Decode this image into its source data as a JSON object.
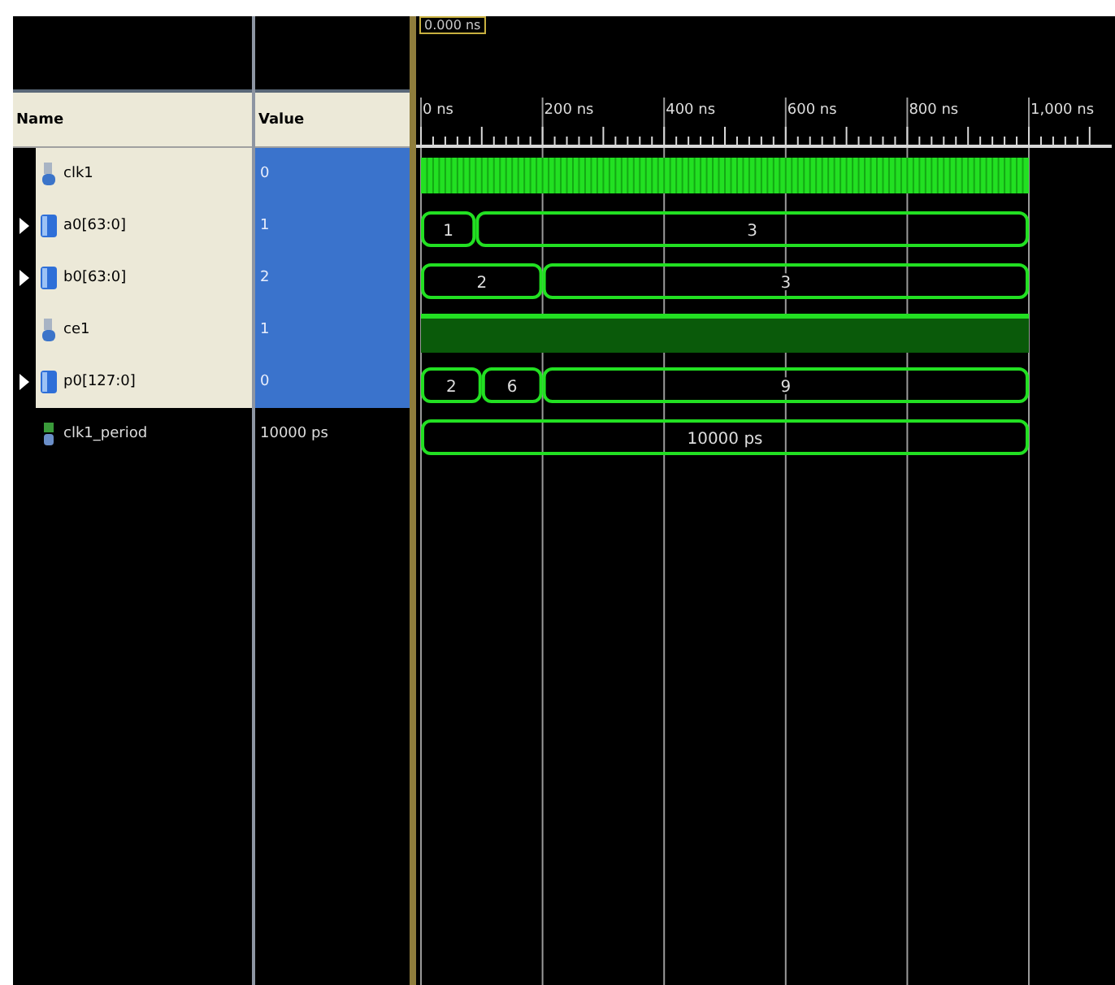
{
  "cursor": {
    "label": "0.000 ns"
  },
  "columns": {
    "name": "Name",
    "value": "Value"
  },
  "ruler": {
    "ticks": [
      "0 ns",
      "200 ns",
      "400 ns",
      "600 ns",
      "800 ns",
      "1,000 ns"
    ]
  },
  "signals": [
    {
      "name": "clk1",
      "value": "0",
      "kind": "clock",
      "selected": true
    },
    {
      "name": "a0[63:0]",
      "value": "1",
      "kind": "bus",
      "selected": true,
      "segments": [
        {
          "label": "1"
        },
        {
          "label": "3"
        }
      ]
    },
    {
      "name": "b0[63:0]",
      "value": "2",
      "kind": "bus",
      "selected": true,
      "segments": [
        {
          "label": "2"
        },
        {
          "label": "3"
        }
      ]
    },
    {
      "name": "ce1",
      "value": "1",
      "kind": "high",
      "selected": true
    },
    {
      "name": "p0[127:0]",
      "value": "0",
      "kind": "bus",
      "selected": true,
      "segments": [
        {
          "label": "2"
        },
        {
          "label": "6"
        },
        {
          "label": "9"
        }
      ]
    },
    {
      "name": "clk1_period",
      "value": "10000 ps",
      "kind": "constant",
      "selected": false,
      "segments": [
        {
          "label": "10000 ps"
        }
      ]
    }
  ]
}
